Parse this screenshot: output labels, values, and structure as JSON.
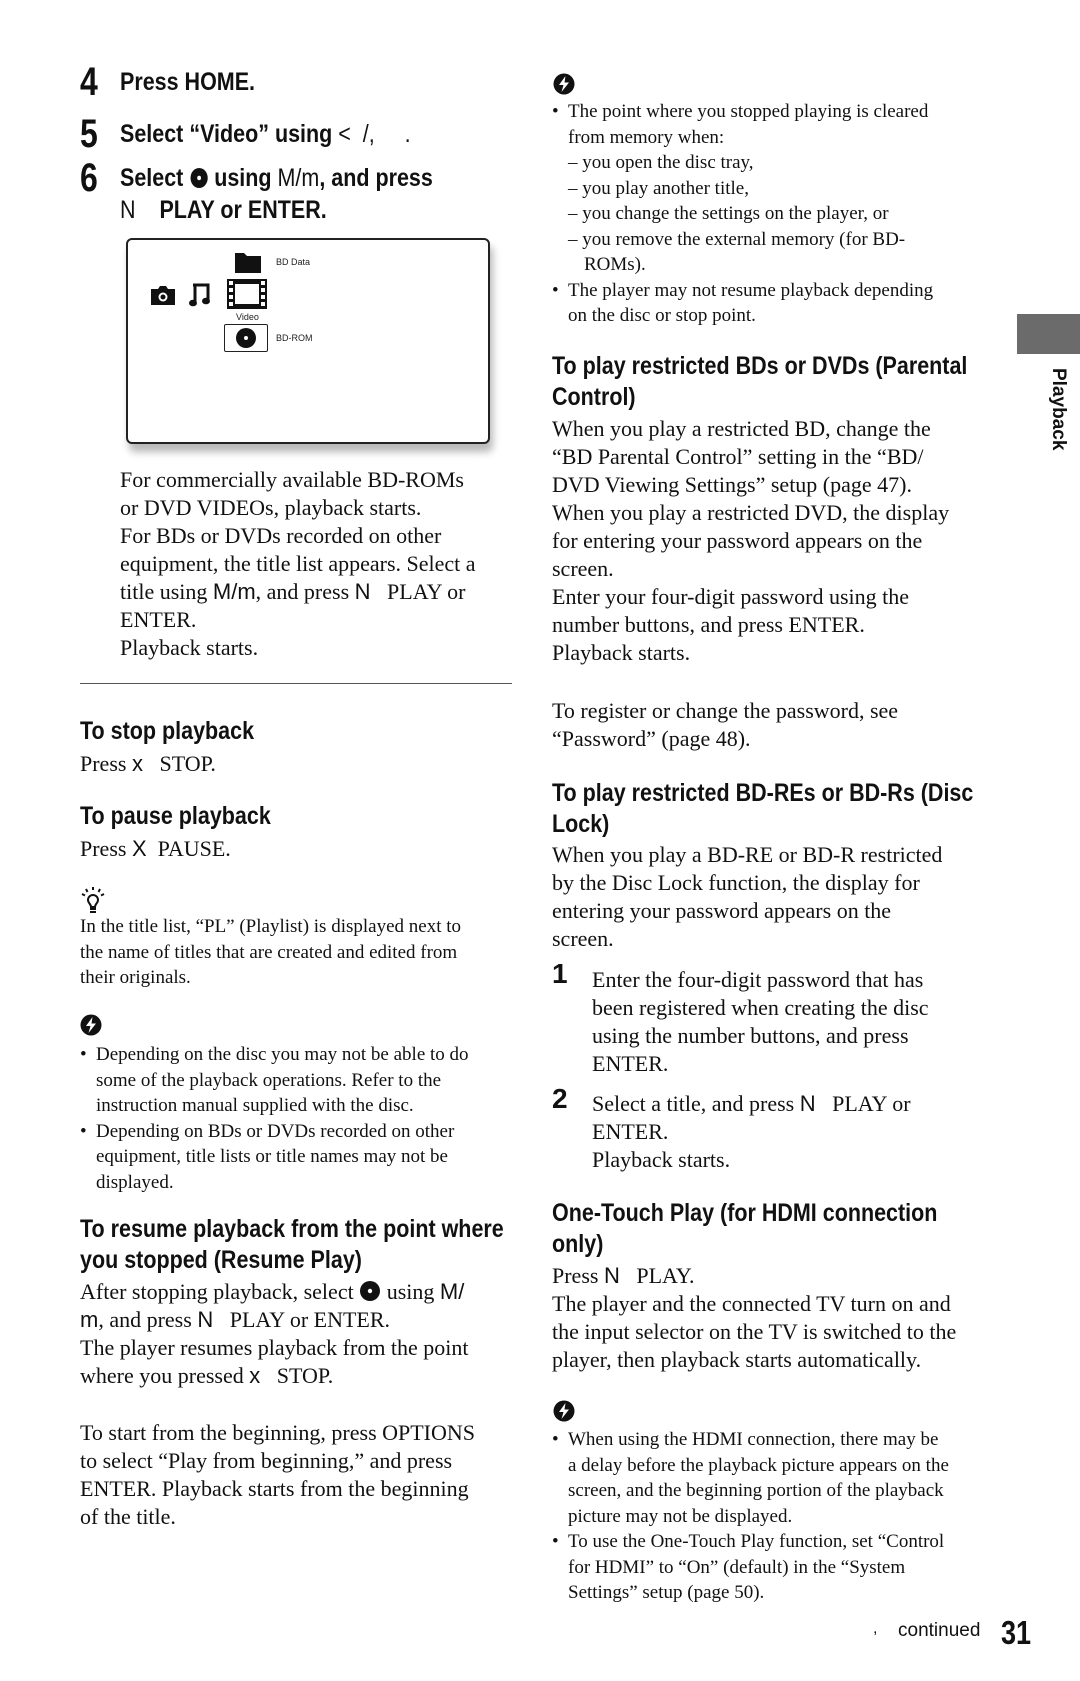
{
  "steps": [
    {
      "num": "4",
      "text": "Press HOME."
    },
    {
      "num": "5",
      "text_before": "Select “Video” using ",
      "key": "<",
      "text_after": "  /,     ."
    },
    {
      "num": "6",
      "text_before": "Select ",
      "icon": "disc-icon",
      "text_mid": " using ",
      "key": "M/m",
      "text_after": ", and press",
      "line2_key": "N",
      "line2_text": "PLAY or ENTER."
    }
  ],
  "screen": {
    "items": [
      {
        "icon": "camera-icon"
      },
      {
        "icon": "music-note-icon"
      },
      {
        "icon": "film-icon",
        "label": "Video"
      },
      {
        "icon": "folder-icon",
        "label": "BD Data"
      },
      {
        "icon": "disc-icon",
        "label": "BD-ROM",
        "selected": true
      }
    ]
  },
  "step6_body": [
    "For commercially available BD-ROMs",
    "or DVD VIDEOs, playback starts.",
    "For BDs or DVDs recorded on other",
    "equipment, the title list appears. Select a",
    {
      "before": "title using ",
      "key": "M/m",
      "mid": ", and press ",
      "key2": "N",
      "after": "   PLAY or"
    },
    "ENTER.",
    "Playback starts."
  ],
  "stop": {
    "heading": "To stop playback",
    "press": "Press ",
    "key": "x",
    "label": "STOP."
  },
  "pause": {
    "heading": "To pause playback",
    "press": "Press ",
    "key": "X",
    "label": "PAUSE."
  },
  "tip": {
    "icon": "lightbulb-icon",
    "lines": [
      "In the title list, “PL” (Playlist) is displayed next to",
      "the name of titles that are created and edited from",
      "their originals."
    ]
  },
  "note_left": {
    "icon": "warning-bolt-icon",
    "bullets": [
      [
        "Depending on the disc you may not be able to do",
        "some of the playback operations. Refer to the",
        "instruction manual supplied with the disc."
      ],
      [
        "Depending on BDs or DVDs recorded on other",
        "equipment, title lists or title names may not be",
        "displayed."
      ]
    ]
  },
  "resume": {
    "heading_lines": [
      "To resume playback from the point where",
      "you stopped (Resume Play)"
    ],
    "line1_before": "After stopping playback, select ",
    "line1_after": " using ",
    "line1_key": "M/",
    "line2_key": "m",
    "line2_mid": ", and press ",
    "line2_key2": "N",
    "line2_after": "   PLAY or ENTER.",
    "line3": "The player resumes playback from the point",
    "line4_before": "where you pressed ",
    "line4_key": "x",
    "line4_after": "   STOP.",
    "para2": [
      "To start from the beginning, press OPTIONS",
      "to select “Play from beginning,” and press",
      "ENTER. Playback starts from the beginning",
      "of the title."
    ]
  },
  "note_right_top": {
    "icon": "warning-bolt-icon",
    "bullet1": [
      "The point where you stopped playing is cleared",
      "from memory when:"
    ],
    "dashes": [
      "– you open the disc tray,",
      "– you play another title,",
      "– you change the settings on the player, or",
      "– you remove the external memory (for BD-"
    ],
    "dash_cont": "ROMs).",
    "bullet2": [
      "The player may not resume playback depending",
      "on the disc or stop point."
    ]
  },
  "parental": {
    "heading_lines": [
      "To play restricted BDs or DVDs (Parental",
      "Control)"
    ],
    "body": [
      "When you play a restricted BD, change the",
      "“BD Parental Control” setting in the “BD/",
      "DVD Viewing Settings” setup (page 47).",
      "When you play a restricted DVD, the display",
      "for entering your password appears on the",
      "screen.",
      "Enter your four-digit password using the",
      "number buttons, and press ENTER.",
      "Playback starts."
    ],
    "register": [
      "To register or change the password, see",
      "“Password” (page 48)."
    ]
  },
  "disclock": {
    "heading_lines": [
      "To play restricted BD-REs or BD-Rs (Disc",
      "Lock)"
    ],
    "body": [
      "When you play a BD-RE or BD-R restricted",
      "by the Disc Lock function, the display for",
      "entering your password appears on the",
      "screen."
    ],
    "steps": [
      {
        "num": "1",
        "lines": [
          "Enter the four-digit password that has",
          "been registered when creating the disc",
          "using the number buttons, and press",
          "ENTER."
        ]
      },
      {
        "num": "2",
        "line1_before": "Select a title, and press ",
        "line1_key": "N",
        "line1_after": "   PLAY or",
        "lines": [
          "ENTER.",
          "Playback starts."
        ]
      }
    ]
  },
  "onetouch": {
    "heading_lines": [
      "One-Touch Play (for HDMI connection",
      "only)"
    ],
    "press": "Press ",
    "key": "N",
    "label": "   PLAY.",
    "body": [
      "The player and the connected TV turn on and",
      "the input selector on the TV is switched to the",
      "player, then playback starts automatically."
    ]
  },
  "note_right_bottom": {
    "icon": "warning-bolt-icon",
    "bullets": [
      [
        "When using the HDMI connection, there may be",
        "a delay before the playback picture appears on the",
        "screen, and the beginning portion of the playback",
        "picture may not be displayed."
      ],
      [
        "To use the One-Touch Play function, set “Control",
        "for HDMI” to “On” (default) in the “System",
        "Settings” setup (page 50)."
      ]
    ]
  },
  "side_tab": {
    "label": "Playback",
    "color": "#6b6b6b"
  },
  "footer": {
    "arrow": ",",
    "continued": "continued",
    "page": "31"
  }
}
